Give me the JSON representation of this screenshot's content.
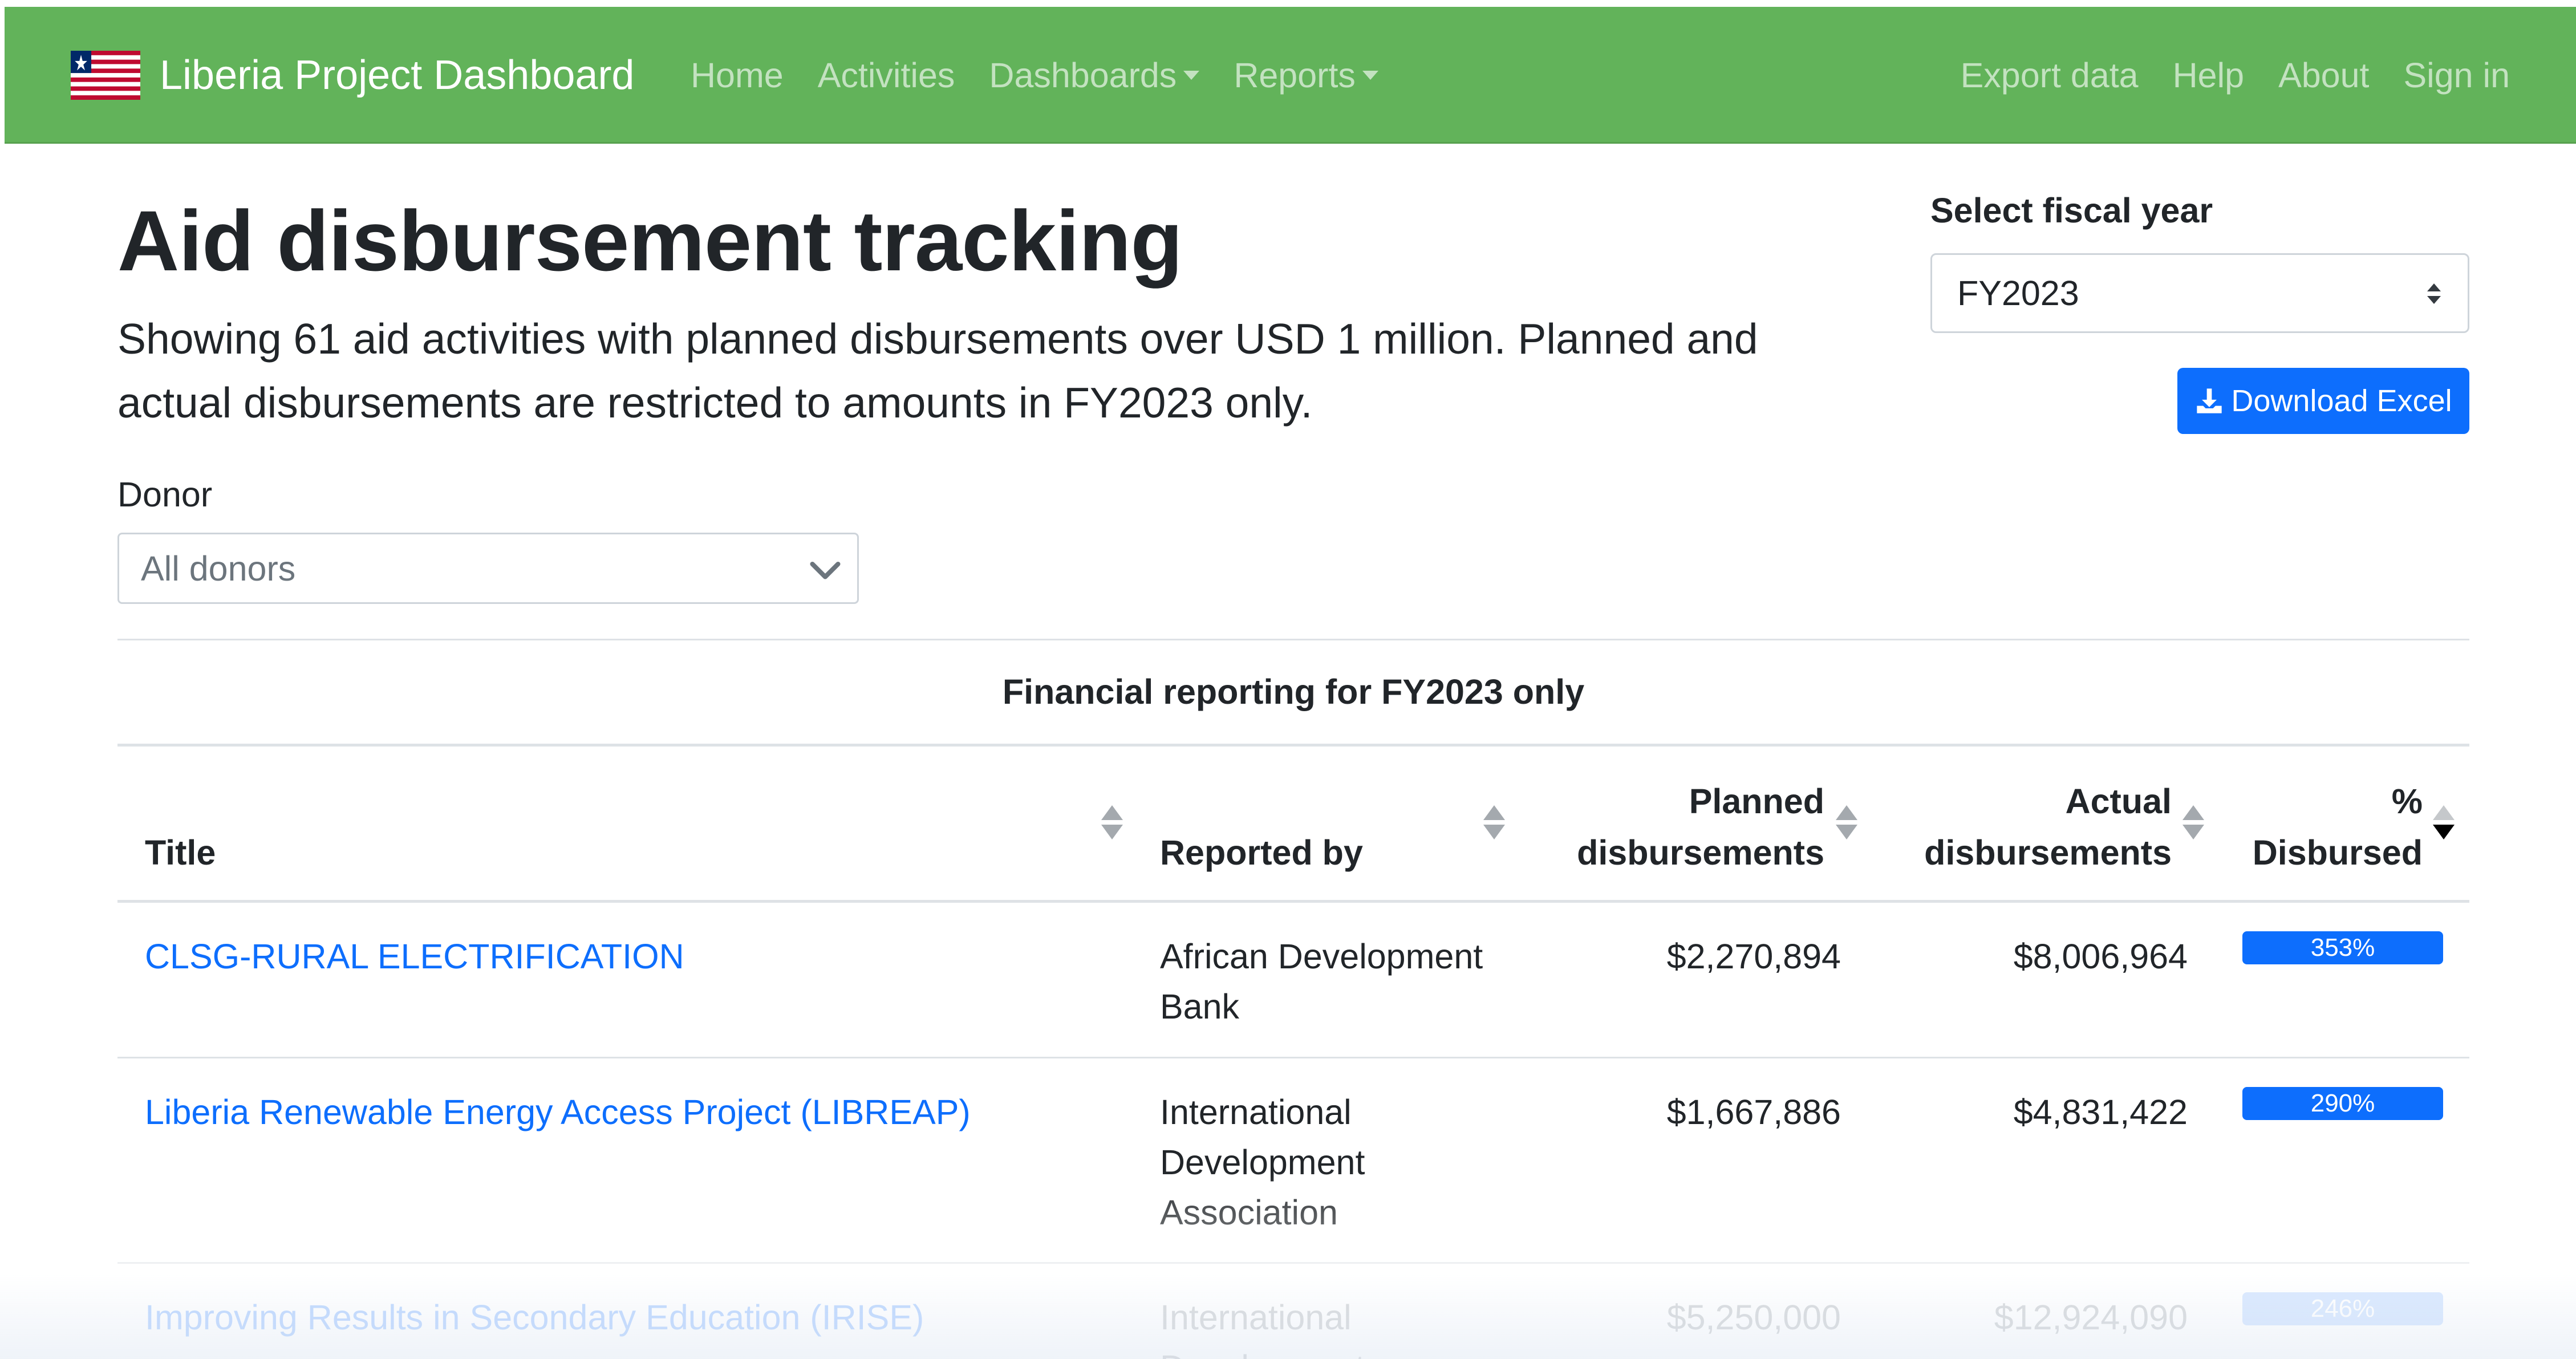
{
  "navbar": {
    "brand": "Liberia Project Dashboard",
    "links_left": [
      {
        "label": "Home",
        "dropdown": false
      },
      {
        "label": "Activities",
        "dropdown": false
      },
      {
        "label": "Dashboards",
        "dropdown": true
      },
      {
        "label": "Reports",
        "dropdown": true
      }
    ],
    "links_right": [
      {
        "label": "Export data"
      },
      {
        "label": "Help"
      },
      {
        "label": "About"
      },
      {
        "label": "Sign in"
      }
    ],
    "background_color": "#62b35a"
  },
  "header": {
    "title": "Aid disbursement tracking",
    "description": "Showing 61 aid activities with planned disbursements over USD 1 million. Planned and actual disbursements are restricted to amounts in FY2023 only."
  },
  "fiscal_year": {
    "label": "Select fiscal year",
    "selected": "FY2023"
  },
  "download": {
    "label": "Download Excel",
    "icon": "download-icon",
    "color": "#0d6efd"
  },
  "donor": {
    "label": "Donor",
    "selected": "All donors"
  },
  "table": {
    "caption": "Financial reporting for FY2023 only",
    "columns": {
      "title": "Title",
      "reported_by": "Reported by",
      "planned_1": "Planned",
      "planned_2": "disbursements",
      "actual_1": "Actual",
      "actual_2": "disbursements",
      "pct_1": "%",
      "pct_2": "Disbursed"
    },
    "rows": [
      {
        "title": "CLSG-RURAL ELECTRIFICATION",
        "reported_by": "African Development Bank",
        "planned": "$2,270,894",
        "actual": "$8,006,964",
        "pct_label": "353%",
        "pct_value": 353
      },
      {
        "title": "Liberia Renewable Energy Access Project (LIBREAP)",
        "reported_by": "International Development Association",
        "planned": "$1,667,886",
        "actual": "$4,831,422",
        "pct_label": "290%",
        "pct_value": 290
      },
      {
        "title": "Improving Results in Secondary Education (IRISE)",
        "reported_by": "International Development",
        "planned": "$5,250,000",
        "actual": "$12,924,090",
        "pct_label": "246%",
        "pct_value": 246
      }
    ]
  }
}
